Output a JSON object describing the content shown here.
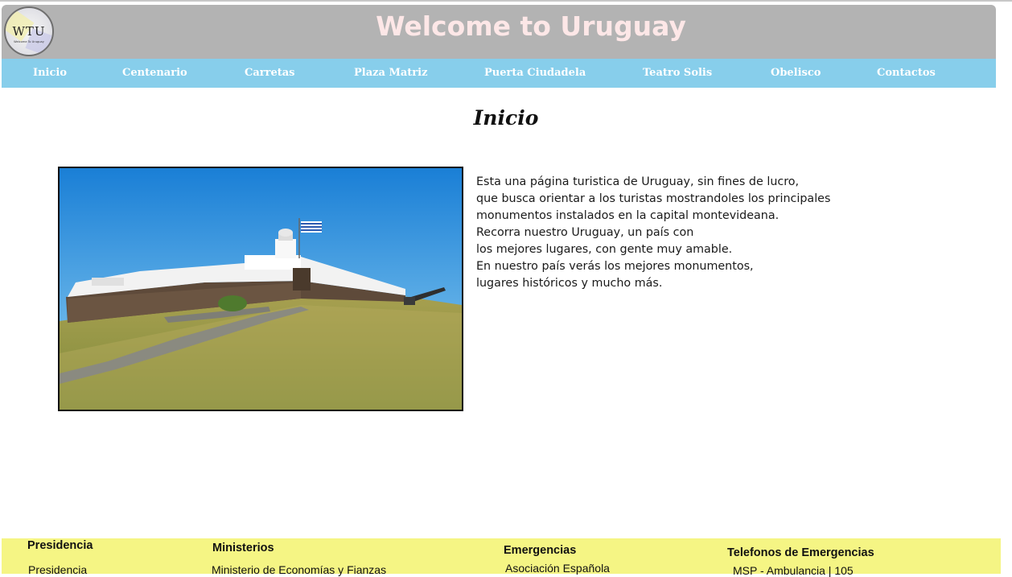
{
  "header": {
    "title": "Welcome to Uruguay",
    "logo_text": "WTU",
    "logo_subtext": "Welcome To Uruguay"
  },
  "nav": {
    "items": [
      {
        "label": "Inicio"
      },
      {
        "label": "Centenario"
      },
      {
        "label": "Carretas"
      },
      {
        "label": "Plaza Matriz"
      },
      {
        "label": "Puerta Ciudadela"
      },
      {
        "label": "Teatro Solis"
      },
      {
        "label": "Obelisco"
      },
      {
        "label": "Contactos"
      }
    ]
  },
  "main": {
    "heading": "Inicio",
    "paragraph_lines": [
      "Esta una página turistica de Uruguay, sin fines de lucro,",
      "que busca orientar a los turistas mostrandoles los principales",
      "monumentos instalados en la capital montevideana.",
      "Recorra nuestro Uruguay, un país con",
      "los mejores lugares, con gente muy amable.",
      "En nuestro país verás los mejores monumentos,",
      "lugares históricos y mucho más."
    ]
  },
  "footer": {
    "columns": [
      {
        "heading": "Presidencia",
        "links": [
          "Presidencia"
        ]
      },
      {
        "heading": "Ministerios",
        "links": [
          "Ministerio de Economías y Fianzas"
        ]
      },
      {
        "heading": "Emergencias",
        "links": [
          "Asociación Española"
        ]
      },
      {
        "heading": "Telefonos de Emergencias",
        "links": [
          "MSP - Ambulancia | 105"
        ]
      }
    ]
  },
  "colors": {
    "header_bg": "#b3b3b3",
    "title_text": "#fde7e7",
    "nav_bg": "#87ceeb",
    "nav_text": "#ffffff",
    "footer_bg": "#f5f584"
  }
}
